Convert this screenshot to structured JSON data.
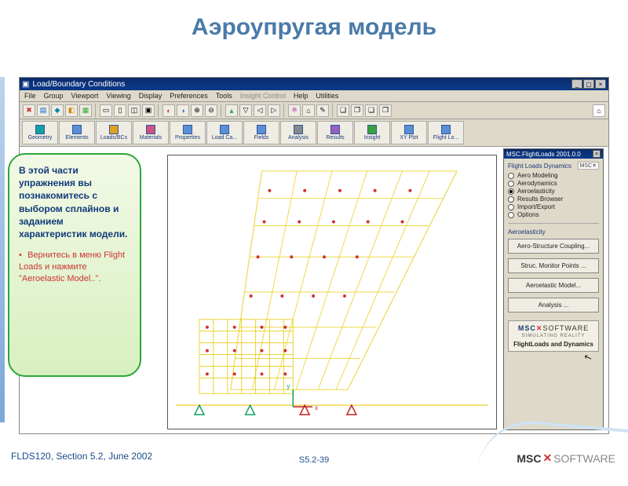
{
  "slide": {
    "title": "Аэроупругая модель"
  },
  "window": {
    "title": "Load/Boundary Conditions",
    "menus": [
      "File",
      "Group",
      "Viewport",
      "Viewing",
      "Display",
      "Preferences",
      "Tools",
      "Insight Control",
      "Help",
      "Utilities"
    ],
    "menu_dim_index": 7,
    "tabs": [
      "Geometry",
      "Elements",
      "Loads/BCs",
      "Materials",
      "Properties",
      "Load Ca...",
      "Fields",
      "Analysis",
      "Results",
      "Insight",
      "XY Plot",
      "Flight Lo..."
    ]
  },
  "info": {
    "text": "В этой части упражнения вы познакомитесь с выбором сплайнов и заданием характеристик модели.",
    "step": "Вернитесь в меню Flight Loads и нажмите \"Aeroelastic Model..\"."
  },
  "sidepanel": {
    "title": "MSC.FlightLoads 2001.0.0",
    "heading": "Flight Loads Dynamics",
    "options": [
      "Aero Modeling",
      "Aerodynamics",
      "Aeroelasticity",
      "Results Browser",
      "Import/Export",
      "Options"
    ],
    "selected_index": 2,
    "section_label": "Aeroelasticity",
    "buttons": [
      "Aero-Structure Coupling...",
      "Struc. Monitor Points ...",
      "Aeroelastic Model...",
      "Analysis ..."
    ],
    "logo_line1a": "MSC",
    "logo_line1b": "SOFTWARE",
    "logo_line2": "SIMULATING REALITY",
    "logo_line3": "FlightLoads and Dynamics"
  },
  "footer": {
    "left": "FLDS120, Section 5.2, June 2002",
    "center": "S5.2-39",
    "logo_a": "MSC",
    "logo_b": "SOFTWARE"
  }
}
